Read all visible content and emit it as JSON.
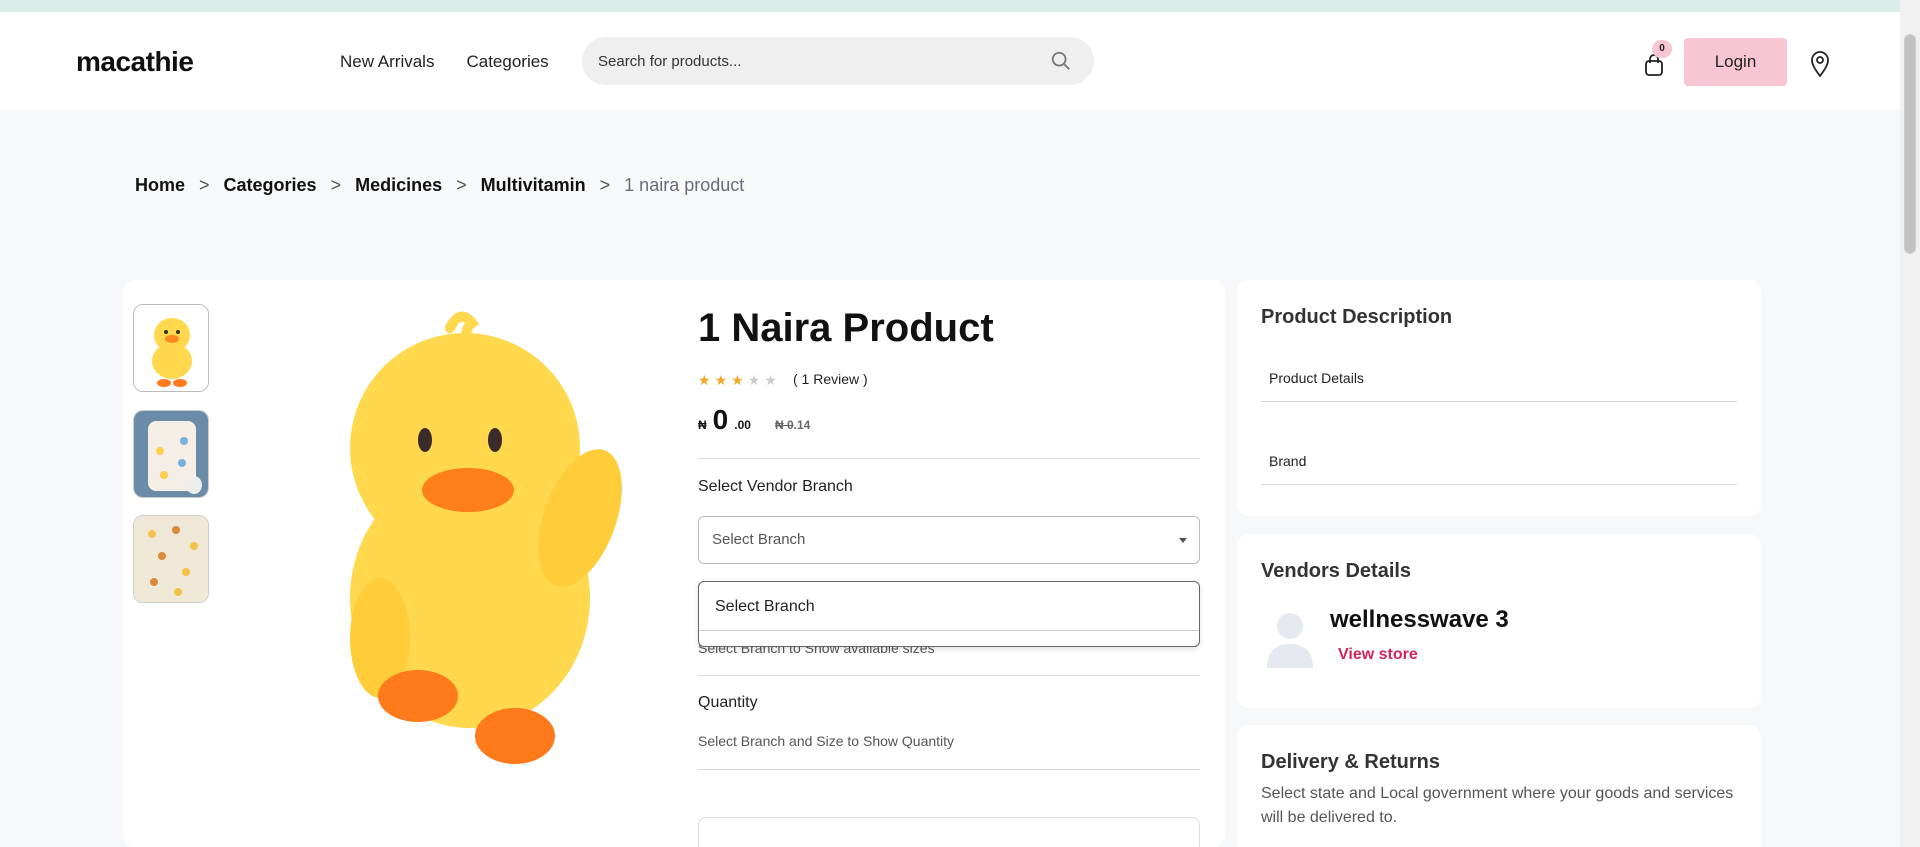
{
  "header": {
    "logo": "macathie",
    "nav": [
      "New Arrivals",
      "Categories"
    ],
    "search_placeholder": "Search for products...",
    "cart_count": "0",
    "login_label": "Login"
  },
  "breadcrumb": {
    "items": [
      "Home",
      "Categories",
      "Medicines",
      "Multivitamin"
    ],
    "separator": ">",
    "current": "1 naira product"
  },
  "product": {
    "title": "1 Naira Product",
    "rating": 3,
    "rating_max": 5,
    "reviews": "( 1 Review )",
    "price": {
      "currency": "₦",
      "whole": "0",
      "decimal": ".00",
      "old_currency": "₦",
      "old_whole": "0",
      "old_decimal": ".14"
    }
  },
  "vendor_branch": {
    "label": "Select Vendor Branch",
    "select_value": "Select Branch",
    "dropdown_option": "Select Branch",
    "size_hint": "Select Branch to Show available sizes"
  },
  "quantity": {
    "label": "Quantity",
    "hint": "Select Branch and Size to Show Quantity"
  },
  "description_panel": {
    "title": "Product Description",
    "rows": [
      "Product Details",
      "Brand"
    ]
  },
  "vendor_panel": {
    "title": "Vendors Details",
    "name": "wellnesswave 3",
    "link": "View store"
  },
  "delivery_panel": {
    "title": "Delivery & Returns",
    "text": "Select state and Local government where your goods and services will be delivered to."
  },
  "colors": {
    "accent_pink": "#f8c6d2",
    "link_red": "#d0245a",
    "star": "#f5a623",
    "top_strip": "#d9eee8"
  }
}
